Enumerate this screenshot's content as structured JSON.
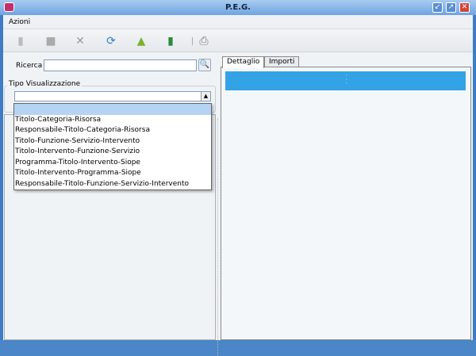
{
  "window": {
    "title": "P.E.G."
  },
  "menu": {
    "items": [
      "Azioni"
    ]
  },
  "toolbar": {
    "buttons": [
      "new-icon",
      "save-icon",
      "delete-icon",
      "refresh-icon",
      "folder-up-icon",
      "binder-icon",
      "print-icon"
    ]
  },
  "search": {
    "label": "Ricerca",
    "value": "",
    "button_icon": "magnifier-icon"
  },
  "view_type": {
    "title": "Tipo Visualizzazione",
    "selected": "",
    "options": [
      "",
      "Titolo-Categoria-Risorsa",
      "Responsabile-Titolo-Categoria-Risorsa",
      "Titolo-Funzione-Servizio-Intervento",
      "Titolo-Intervento-Funzione-Servizio",
      "Programma-Titolo-Intervento-Siope",
      "Titolo-Intervento-Programma-Siope",
      "Responsabile-Titolo-Funzione-Servizio-Intervento"
    ]
  },
  "tabs": [
    {
      "label": "Dettaglio",
      "active": true
    },
    {
      "label": "Importi",
      "active": false
    }
  ],
  "colors": {
    "accent": "#33a3e6"
  }
}
